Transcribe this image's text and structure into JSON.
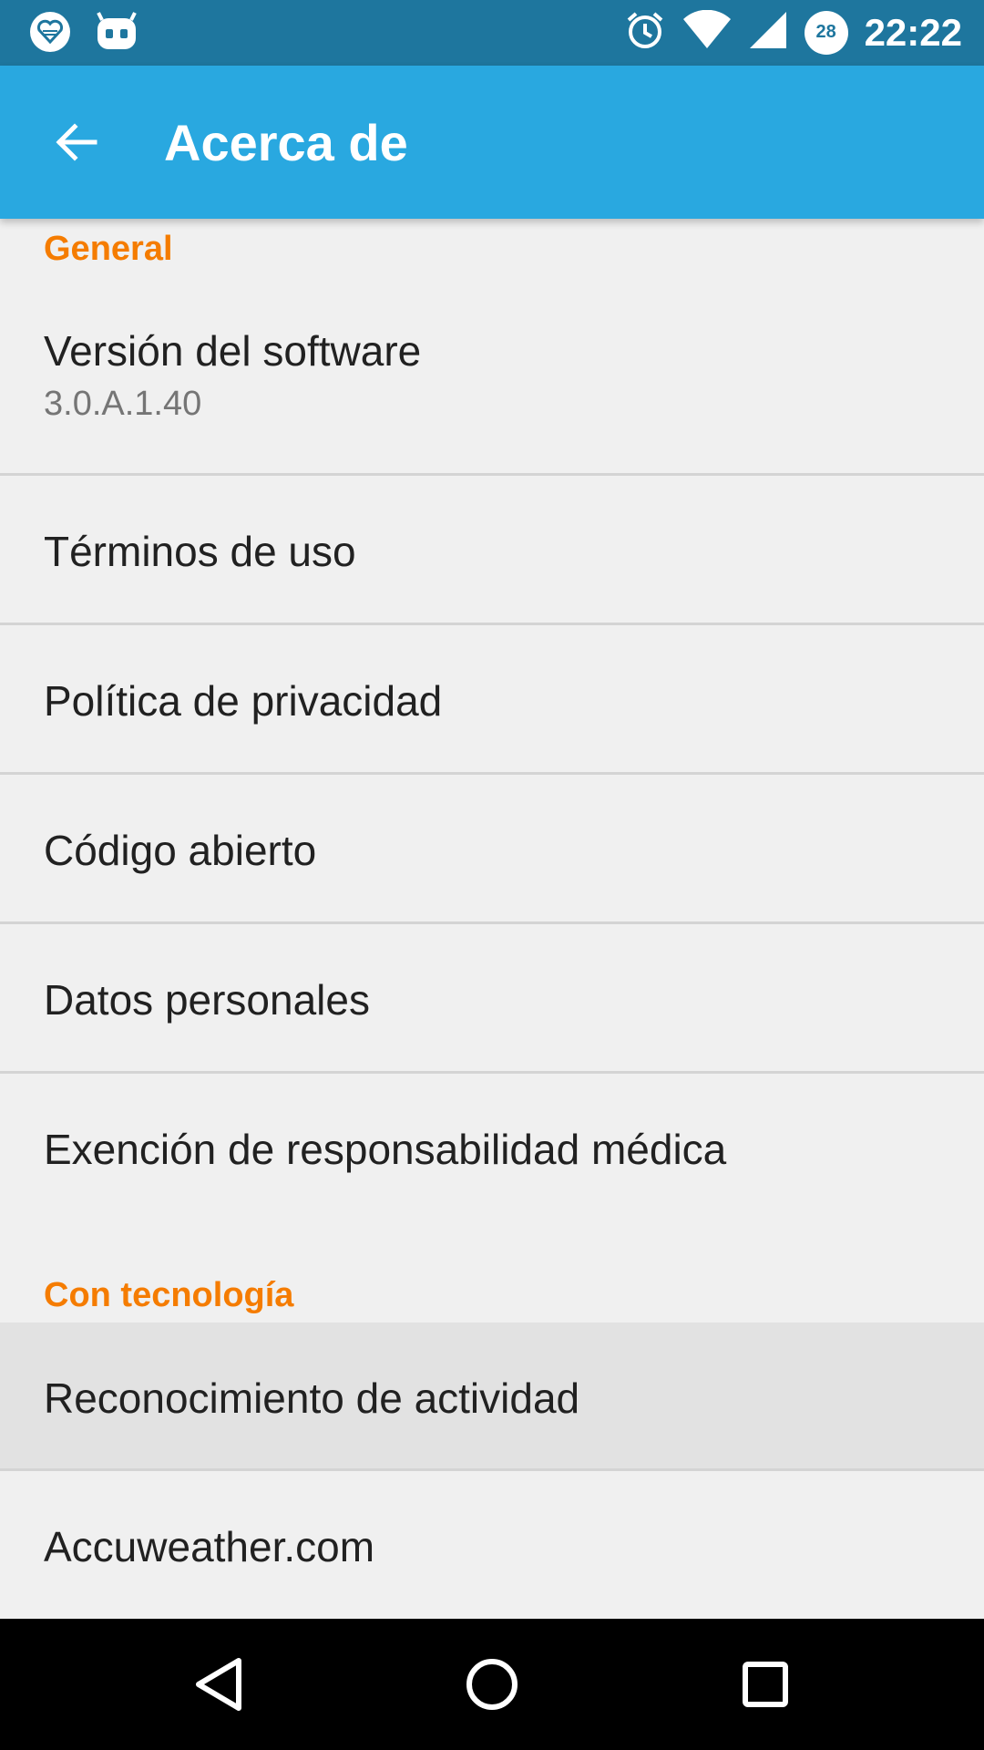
{
  "status_bar": {
    "time": "22:22",
    "battery_level": "28",
    "icons": [
      "heart-notification-icon",
      "cyanogen-icon",
      "alarm-icon",
      "wifi-icon",
      "cell-signal-icon",
      "battery-icon"
    ]
  },
  "app_bar": {
    "title": "Acerca de",
    "back_icon": "arrow-back-icon"
  },
  "sections": {
    "general": "General",
    "powered_by": "Con tecnología"
  },
  "items": {
    "software_version": {
      "title": "Versión del software",
      "subtitle": "3.0.A.1.40"
    },
    "terms": {
      "title": "Términos de uso"
    },
    "privacy": {
      "title": "Política de privacidad"
    },
    "open_source": {
      "title": "Código abierto"
    },
    "personal_data": {
      "title": "Datos personales"
    },
    "medical": {
      "title": "Exención de responsabilidad médica"
    },
    "activity": {
      "title": "Reconocimiento de actividad"
    },
    "accuweather": {
      "title": "Accuweather.com"
    }
  },
  "colors": {
    "status_bar": "#1e769e",
    "app_bar": "#29a8e0",
    "section_accent": "#f57c00",
    "background": "#f0f0f0",
    "pressed_row": "#e2e2e2"
  },
  "nav_bar": {
    "back": "nav-back-icon",
    "home": "nav-home-icon",
    "recents": "nav-recents-icon"
  }
}
